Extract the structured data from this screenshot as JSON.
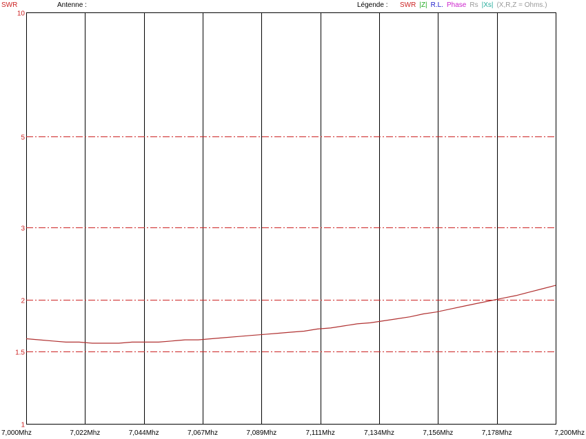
{
  "header": {
    "swr_label": "SWR",
    "antenna_label": "Antenne :",
    "legend_label": "Légende :",
    "legend_items": [
      {
        "text": "SWR",
        "color": "#cc2222"
      },
      {
        "text": "|Z|",
        "color": "#22aa22"
      },
      {
        "text": "R.L.",
        "color": "#2222cc"
      },
      {
        "text": "Phase",
        "color": "#cc22cc"
      },
      {
        "text": "Rs",
        "color": "#999999"
      },
      {
        "text": "|Xs|",
        "color": "#22aa99"
      },
      {
        "text": "(X,R,Z = Ohms.)",
        "color": "#999999"
      }
    ]
  },
  "colors": {
    "curve": "#b03030",
    "grid_h": "#cc2222",
    "grid_v": "#000000",
    "axis_text": "#cc2222"
  },
  "chart_data": {
    "type": "line",
    "ylabel": "SWR",
    "yscale": "log",
    "ylim": [
      1,
      10
    ],
    "xlim": [
      7.0,
      7.2
    ],
    "y_ticks": [
      1,
      1.5,
      2,
      3,
      5,
      10
    ],
    "y_tick_labels": [
      "1",
      "1.5",
      "2",
      "3",
      "5",
      "10"
    ],
    "x_ticks": [
      7.0,
      7.022,
      7.044,
      7.067,
      7.089,
      7.111,
      7.134,
      7.156,
      7.178,
      7.2
    ],
    "x_tick_labels": [
      "7,000Mhz",
      "7,022Mhz",
      "7,044Mhz",
      "7,067Mhz",
      "7,089Mhz",
      "7,111Mhz",
      "7,134Mhz",
      "7,156Mhz",
      "7,178Mhz",
      "7,200Mhz"
    ],
    "series": [
      {
        "x": [
          7.0,
          7.005,
          7.01,
          7.015,
          7.02,
          7.025,
          7.03,
          7.035,
          7.04,
          7.044,
          7.05,
          7.055,
          7.06,
          7.065,
          7.07,
          7.075,
          7.08,
          7.085,
          7.09,
          7.095,
          7.1,
          7.105,
          7.11,
          7.115,
          7.12,
          7.125,
          7.13,
          7.135,
          7.14,
          7.145,
          7.15,
          7.155,
          7.16,
          7.165,
          7.17,
          7.175,
          7.18,
          7.185,
          7.19,
          7.195,
          7.2
        ],
        "values": [
          1.61,
          1.6,
          1.59,
          1.58,
          1.58,
          1.57,
          1.57,
          1.57,
          1.58,
          1.58,
          1.58,
          1.59,
          1.6,
          1.6,
          1.61,
          1.62,
          1.63,
          1.64,
          1.65,
          1.66,
          1.67,
          1.68,
          1.7,
          1.71,
          1.73,
          1.75,
          1.76,
          1.78,
          1.8,
          1.82,
          1.85,
          1.87,
          1.9,
          1.93,
          1.96,
          1.99,
          2.02,
          2.05,
          2.09,
          2.13,
          2.17
        ]
      }
    ]
  }
}
